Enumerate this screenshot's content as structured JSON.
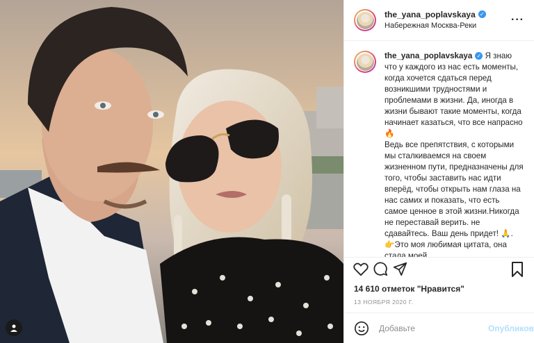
{
  "post": {
    "username": "the_yana_poplavskaya",
    "verified_mark": "✓",
    "location": "Набережная Москва-Реки",
    "more_icon": "more-horizontal-icon",
    "caption": "Я знаю что у каждого из нас есть моменты, когда хочется сдаться перед возникшими трудностями и проблемами в жизни. Да, иногда в жизни бывают такие моменты, когда начинает казаться, что все напрасно 🔥\nВедь все препятствия, с которыми мы сталкиваемся на своем жизненном пути, предназначены для того, чтобы заставить нас идти вперёд, чтобы открыть нам глаза на нас самих и показать, что есть самое ценное в этой жизни.Никогда не переставай верить. не сдавайтесь. Ваш день придет! 🙏. 👉Это моя любимая цитата, она стала моей",
    "likes": "14 610 отметок \"Нравится\"",
    "date": "13 НОЯБРЯ 2020 Г."
  },
  "actions": {
    "like_icon": "heart-icon",
    "comment_icon": "comment-icon",
    "share_icon": "share-icon",
    "save_icon": "bookmark-icon"
  },
  "comment_box": {
    "placeholder": "Добавьте",
    "publish_label": "Опубликовать",
    "emoji_icon": "emoji-icon"
  },
  "colors": {
    "verified": "#3897f0",
    "publish_disabled": "#b2dffc",
    "muted": "#8e8e8e"
  }
}
